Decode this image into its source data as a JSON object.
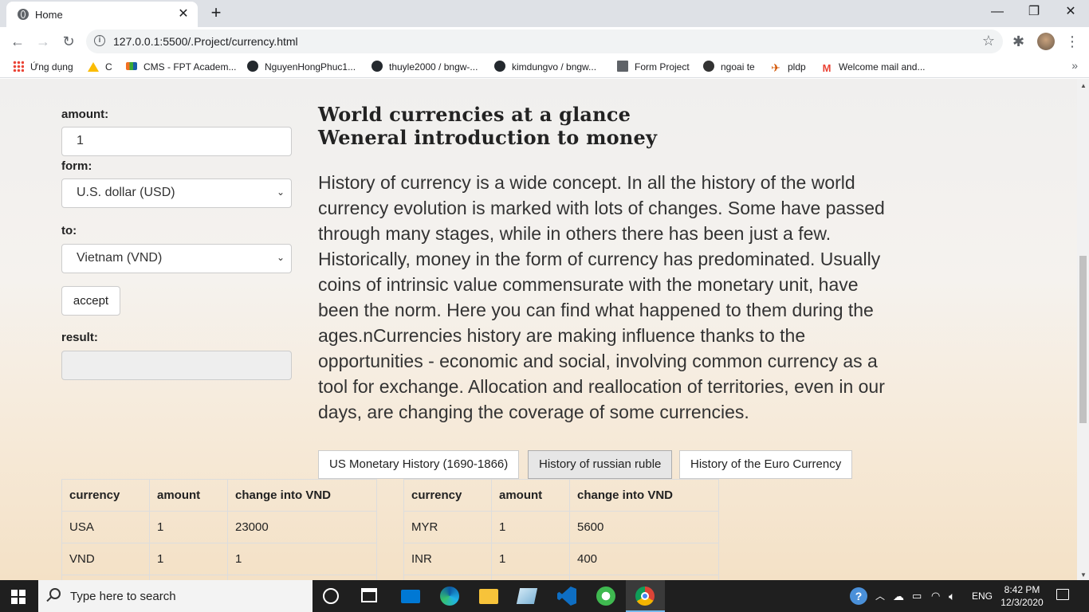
{
  "browser": {
    "tab_title": "Home",
    "url": "127.0.0.1:5500/.Project/currency.html",
    "bookmarks": [
      {
        "label": "Ứng dụng",
        "icon": "apps-grid-icon"
      },
      {
        "label": "C",
        "icon": "google-drive-icon"
      },
      {
        "label": "CMS - FPT Academ...",
        "icon": "fpt-icon"
      },
      {
        "label": "NguyenHongPhuc1...",
        "icon": "github-icon"
      },
      {
        "label": "thuyle2000 / bngw-...",
        "icon": "github-icon"
      },
      {
        "label": "kimdungvo / bngw...",
        "icon": "github-icon"
      },
      {
        "label": "Form Project",
        "icon": "form-icon"
      },
      {
        "label": "ngoai te",
        "icon": "ngoai-te-icon"
      },
      {
        "label": "pldp",
        "icon": "pldp-icon"
      },
      {
        "label": "Welcome mail and...",
        "icon": "gmail-icon"
      }
    ]
  },
  "converter": {
    "amount_label": "amount:",
    "amount_value": "1",
    "from_label": "form:",
    "from_value": "U.S. dollar (USD)",
    "to_label": "to:",
    "to_value": "Vietnam (VND)",
    "accept_label": "accept",
    "result_label": "result:",
    "result_value": ""
  },
  "article": {
    "heading1": "World currencies at a glance",
    "heading2": "Weneral introduction to money",
    "paragraph": "History of currency is a wide concept. In all the history of the world currency evolution is marked with lots of changes. Some have passed through many stages, while in others there has been just a few. Historically, money in the form of currency has predominated. Usually coins of intrinsic value commensurate with the monetary unit, have been the norm. Here you can find what happened to them during the ages.nCurrencies history are making influence thanks to the opportunities - economic and social, involving common currency as a tool for exchange. Allocation and reallocation of territories, even in our days, are changing the coverage of some currencies."
  },
  "history_tabs": [
    {
      "label": "US Monetary History (1690-1866)",
      "active": false
    },
    {
      "label": "History of russian ruble",
      "active": true
    },
    {
      "label": "History of the Euro Currency",
      "active": false
    }
  ],
  "table_left": {
    "headers": [
      "currency",
      "amount",
      "change into VND"
    ],
    "rows": [
      [
        "USA",
        "1",
        "23000"
      ],
      [
        "VND",
        "1",
        "1"
      ]
    ]
  },
  "table_right": {
    "headers": [
      "currency",
      "amount",
      "change into VND"
    ],
    "rows": [
      [
        "MYR",
        "1",
        "5600"
      ],
      [
        "INR",
        "1",
        "400"
      ]
    ]
  },
  "taskbar": {
    "search_placeholder": "Type here to search",
    "language": "ENG",
    "time": "8:42 PM",
    "date": "12/3/2020"
  }
}
